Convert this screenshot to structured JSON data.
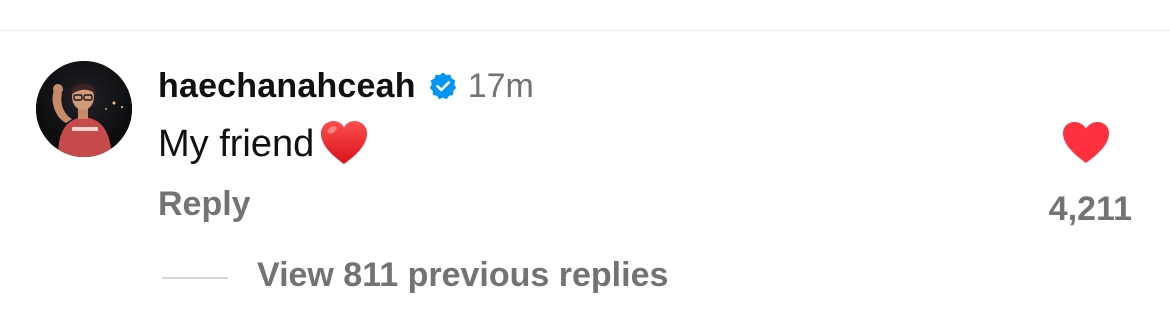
{
  "comment": {
    "username": "haechanahceah",
    "verified_icon": "verified-badge-icon",
    "timestamp": "17m",
    "text": "My friend",
    "emoji": "red-heart-emoji",
    "reply_label": "Reply",
    "like_icon": "heart-icon",
    "like_count": "4,211",
    "liked": true,
    "view_replies_label": "View 811 previous replies"
  },
  "colors": {
    "text_primary": "#111111",
    "text_secondary": "#737373",
    "verified_blue": "#0095f6",
    "like_red": "#ff3040"
  }
}
